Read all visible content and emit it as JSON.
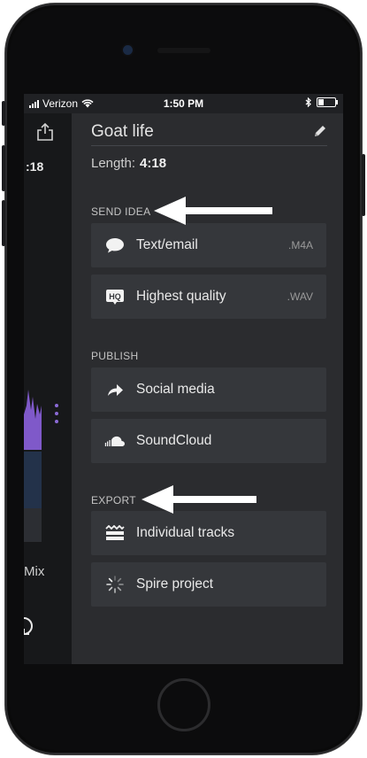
{
  "status_bar": {
    "carrier": "Verizon",
    "time": "1:50 PM",
    "battery_level": 0.35
  },
  "left_panel": {
    "length_partial": ":18",
    "mix_label": "Mix",
    "share_icon": "share-icon",
    "refresh_icon": "refresh-icon"
  },
  "drawer": {
    "title": "Goat life",
    "edit_icon": "pencil-icon",
    "length_label": "Length:",
    "length_value": "4:18",
    "sections": [
      {
        "header": "SEND IDEA",
        "rows": [
          {
            "label": "Text/email",
            "format": ".M4A",
            "icon": "chat-bubble-icon"
          },
          {
            "label": "Highest quality",
            "format": ".WAV",
            "icon": "hq-icon"
          }
        ]
      },
      {
        "header": "PUBLISH",
        "rows": [
          {
            "label": "Social media",
            "format": "",
            "icon": "share-arrow-icon"
          },
          {
            "label": "SoundCloud",
            "format": "",
            "icon": "soundcloud-icon"
          }
        ]
      },
      {
        "header": "EXPORT",
        "rows": [
          {
            "label": "Individual tracks",
            "format": "",
            "icon": "tracks-icon"
          },
          {
            "label": "Spire project",
            "format": "",
            "icon": "spire-icon"
          }
        ]
      }
    ]
  },
  "colors": {
    "screen_bg": "#202124",
    "drawer_bg": "#2b2c2f",
    "row_bg": "#35373b",
    "accent_purple": "#8b6ad6",
    "annotation_arrow": "#ffffff"
  }
}
